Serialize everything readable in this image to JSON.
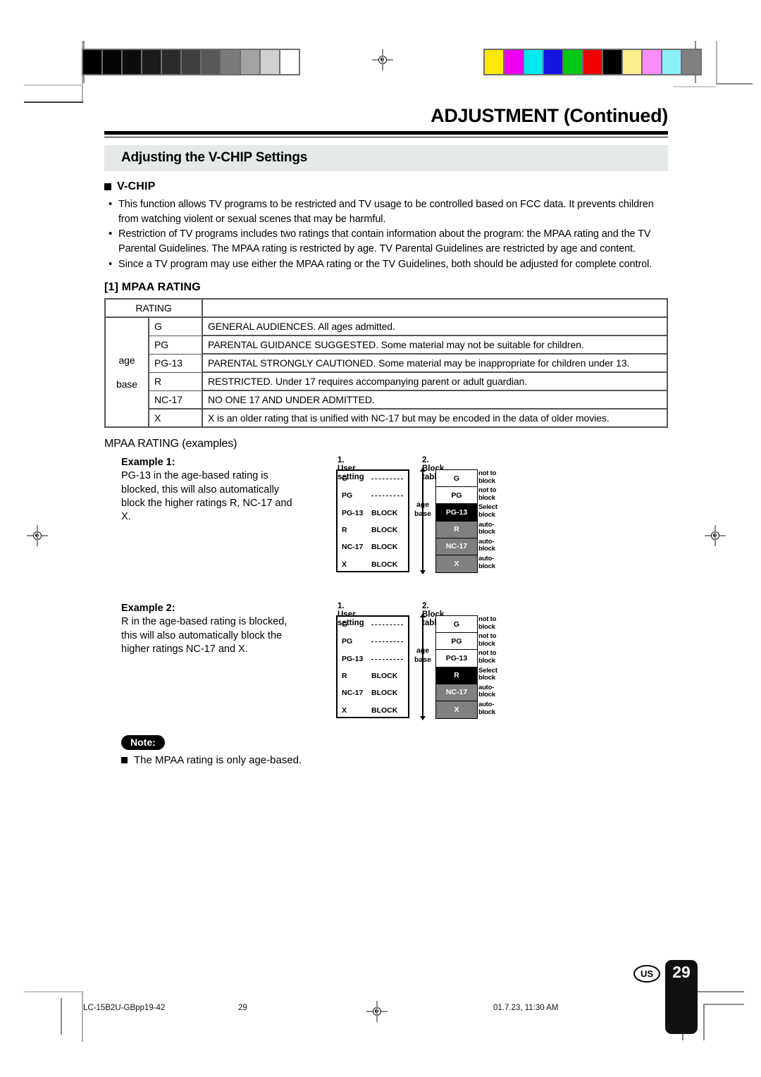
{
  "header": {
    "doc_title": "ADJUSTMENT (Continued)",
    "section_band": "Adjusting the V-CHIP Settings",
    "subsection": "V-CHIP"
  },
  "bullets": [
    "This function allows TV programs to be restricted and TV usage to be controlled based on FCC data. It prevents children from watching violent or sexual scenes that may be harmful.",
    "Restriction of TV programs includes two ratings that contain information about the program: the MPAA rating and the TV Parental Guidelines. The MPAA rating is restricted by age. TV Parental Guidelines are restricted by age and content.",
    "Since a TV program may use either the MPAA rating or the TV Guidelines, both should be adjusted for complete control."
  ],
  "mpaa_table": {
    "heading": "[1] MPAA RATING",
    "col_header": "RATING",
    "group_label_line1": "age",
    "group_label_line2": "base",
    "rows": [
      {
        "code": "G",
        "desc": "GENERAL AUDIENCES. All ages admitted."
      },
      {
        "code": "PG",
        "desc": "PARENTAL GUIDANCE SUGGESTED. Some material may not be suitable for children."
      },
      {
        "code": "PG-13",
        "desc": "PARENTAL STRONGLY CAUTIONED.  Some material may be inappropriate for children under 13."
      },
      {
        "code": "R",
        "desc": "RESTRICTED. Under 17 requires accompanying parent or adult guardian."
      },
      {
        "code": "NC-17",
        "desc": "NO ONE 17 AND UNDER ADMITTED."
      },
      {
        "code": "X",
        "desc": "X is an older rating that is unified with NC-17 but may be encoded in the data of older movies."
      }
    ]
  },
  "examples_heading": "MPAA RATING (examples)",
  "diagram_labels": {
    "user_setting_heading": "1. User setting",
    "block_table_heading": "2. Block table",
    "age_line1": "age",
    "age_line2": "base",
    "block_value": "BLOCK",
    "note_not_to": "not to block",
    "note_select": "Select block",
    "note_auto": "auto- block"
  },
  "example1": {
    "title": "Example 1:",
    "body": "PG-13 in the age-based rating is blocked, this will also automatically block the higher ratings R, NC-17 and X.",
    "user_setting": [
      {
        "code": "G",
        "value": "",
        "dashed": true
      },
      {
        "code": "PG",
        "value": "",
        "dashed": true
      },
      {
        "code": "PG-13",
        "value": "BLOCK",
        "dashed": false
      },
      {
        "code": "R",
        "value": "BLOCK",
        "dashed": false
      },
      {
        "code": "NC-17",
        "value": "BLOCK",
        "dashed": false
      },
      {
        "code": "X",
        "value": "BLOCK",
        "dashed": false
      }
    ],
    "block_table": [
      {
        "code": "G",
        "state": "white",
        "note1": "not to",
        "note2": "block"
      },
      {
        "code": "PG",
        "state": "white",
        "note1": "not to",
        "note2": "block"
      },
      {
        "code": "PG-13",
        "state": "black",
        "note1": "Select",
        "note2": "block"
      },
      {
        "code": "R",
        "state": "gray",
        "note1": "auto-",
        "note2": "block"
      },
      {
        "code": "NC-17",
        "state": "gray",
        "note1": "auto-",
        "note2": "block"
      },
      {
        "code": "X",
        "state": "gray",
        "note1": "auto-",
        "note2": "block"
      }
    ]
  },
  "example2": {
    "title": "Example 2:",
    "body": "R in the age-based rating is blocked, this will also automatically block the higher ratings NC-17 and X.",
    "user_setting": [
      {
        "code": "G",
        "value": "",
        "dashed": true
      },
      {
        "code": "PG",
        "value": "",
        "dashed": true
      },
      {
        "code": "PG-13",
        "value": "",
        "dashed": true
      },
      {
        "code": "R",
        "value": "BLOCK",
        "dashed": false
      },
      {
        "code": "NC-17",
        "value": "BLOCK",
        "dashed": false
      },
      {
        "code": "X",
        "value": "BLOCK",
        "dashed": false
      }
    ],
    "block_table": [
      {
        "code": "G",
        "state": "white",
        "note1": "not to",
        "note2": "block"
      },
      {
        "code": "PG",
        "state": "white",
        "note1": "not to",
        "note2": "block"
      },
      {
        "code": "PG-13",
        "state": "white",
        "note1": "not to",
        "note2": "block"
      },
      {
        "code": "R",
        "state": "black",
        "note1": "Select",
        "note2": "block"
      },
      {
        "code": "NC-17",
        "state": "gray",
        "note1": "auto-",
        "note2": "block"
      },
      {
        "code": "X",
        "state": "gray",
        "note1": "auto-",
        "note2": "block"
      }
    ]
  },
  "note": {
    "tag": "Note:",
    "text": "The MPAA rating is only age-based."
  },
  "footer": {
    "file": "LC-15B2U-GBpp19-42",
    "page": "29",
    "timestamp": "01.7.23, 11:30 AM",
    "region": "US",
    "page_number": "29"
  },
  "print_marks": {
    "grayscale_wedge": [
      "#000000",
      "#040404",
      "#0d0d0d",
      "#1b1b1b",
      "#2b2b2b",
      "#3f3f3f",
      "#585858",
      "#7a7a7a",
      "#a3a3a3",
      "#d0d0d0",
      "#ffffff"
    ],
    "color_bars": [
      "#ffe800",
      "#f000f0",
      "#00e8f0",
      "#1414e0",
      "#00c814",
      "#f00000",
      "#000000",
      "#fbf08c",
      "#fb8cfb",
      "#8cf0fb",
      "#808080"
    ]
  }
}
